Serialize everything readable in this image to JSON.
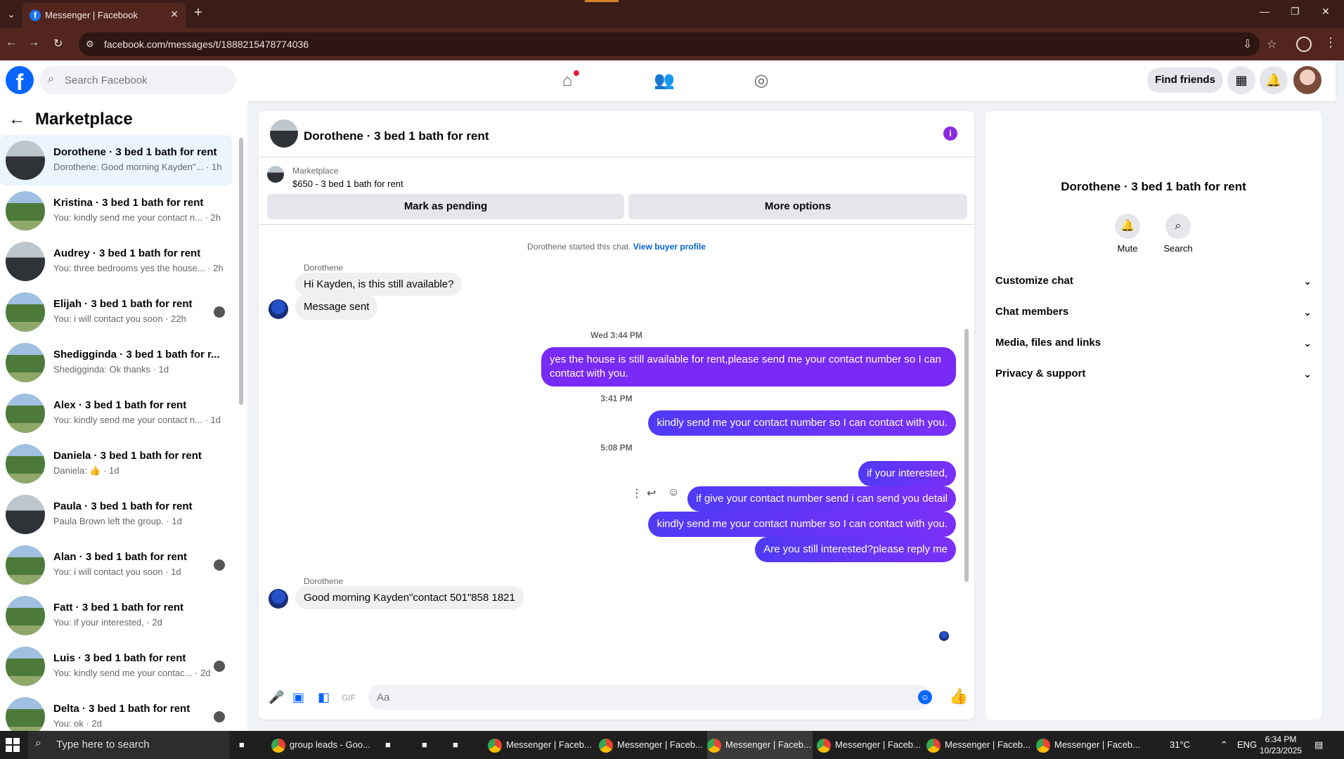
{
  "browser": {
    "tab_title": "Messenger | Facebook",
    "url": "facebook.com/messages/t/1888215478774036"
  },
  "fb": {
    "search_placeholder": "Search Facebook",
    "find_friends": "Find friends"
  },
  "list": {
    "heading": "Marketplace",
    "conversations": [
      {
        "name": "Dorothene · 3 bed 1 bath for rent",
        "preview": "Dorothene: Good morning Kayden\"... · 1h",
        "avatar": "house-dark",
        "selected": true
      },
      {
        "name": "Kristina · 3 bed 1 bath for rent",
        "preview": "You: kindly send me your contact n... · 2h",
        "avatar": "house-green"
      },
      {
        "name": "Audrey · 3 bed 1 bath for rent",
        "preview": "You: three bedrooms yes the house... · 2h",
        "avatar": "house-dark"
      },
      {
        "name": "Elijah · 3 bed 1 bath for rent",
        "preview": "You: i will contact you soon · 22h",
        "avatar": "house-green",
        "read": true
      },
      {
        "name": "Shedigginda · 3 bed 1 bath for r...",
        "preview": "Shedigginda: Ok thanks · 1d",
        "avatar": "house-green"
      },
      {
        "name": "Alex · 3 bed 1 bath for rent",
        "preview": "You: kindly send me your contact n... · 1d",
        "avatar": "house-green"
      },
      {
        "name": "Daniela · 3 bed 1 bath for rent",
        "preview": "Daniela: 👍 · 1d",
        "avatar": "house-green"
      },
      {
        "name": "Paula · 3 bed 1 bath for rent",
        "preview": "Paula Brown left the group. · 1d",
        "avatar": "house-dark"
      },
      {
        "name": "Alan · 3 bed 1 bath for rent",
        "preview": "You: i will contact you soon · 1d",
        "avatar": "house-green",
        "read": true
      },
      {
        "name": "Fatt · 3 bed 1 bath for rent",
        "preview": "You: if your interested, · 2d",
        "avatar": "house-green"
      },
      {
        "name": "Luis · 3 bed 1 bath for rent",
        "preview": "You: kindly send me your contac... · 2d",
        "avatar": "house-green",
        "read": true
      },
      {
        "name": "Delta · 3 bed 1 bath for rent",
        "preview": "You: ok · 2d",
        "avatar": "house-green",
        "read": true
      }
    ]
  },
  "chat": {
    "title": "Dorothene · 3 bed 1 bath for rent",
    "marketplace_label": "Marketplace",
    "listing": "$650 - 3 bed 1 bath for rent",
    "mark_pending": "Mark as pending",
    "more_options": "More options",
    "started_text": "Dorothene started this chat.",
    "view_buyer": "View buyer profile",
    "sender1": "Dorothene",
    "in1": "Hi Kayden, is this still available?",
    "in2": "Message sent",
    "t1": "Wed 3:44 PM",
    "out1": "yes the house is still available for rent,please send me your contact number so I can contact with you.",
    "t2": "3:41 PM",
    "out2": "kindly send me your contact number so I can contact with you.",
    "t3": "5:08 PM",
    "out3": "if your interested,",
    "out4": "if give your contact number send i can send you detail",
    "out5": "kindly send me your contact number so I can contact with you.",
    "out6": "Are you still interested?please reply me",
    "sender2": "Dorothene",
    "in3": "Good morning Kayden\"contact 501\"858 1821",
    "composer_placeholder": "Aa"
  },
  "right": {
    "name": "Dorothene · 3 bed 1 bath for rent",
    "mute": "Mute",
    "search": "Search",
    "sections": [
      "Customize chat",
      "Chat members",
      "Media, files and links",
      "Privacy & support"
    ]
  },
  "taskbar": {
    "search_placeholder": "Type here to search",
    "apps": [
      "group leads - Goo...",
      "Messenger | Faceb...",
      "Messenger | Faceb...",
      "Messenger | Faceb...",
      "Messenger | Faceb...",
      "Messenger | Faceb...",
      "Messenger | Faceb..."
    ],
    "temp": "31°C",
    "lang": "ENG",
    "time": "6:34 PM",
    "date": "10/23/2025"
  }
}
